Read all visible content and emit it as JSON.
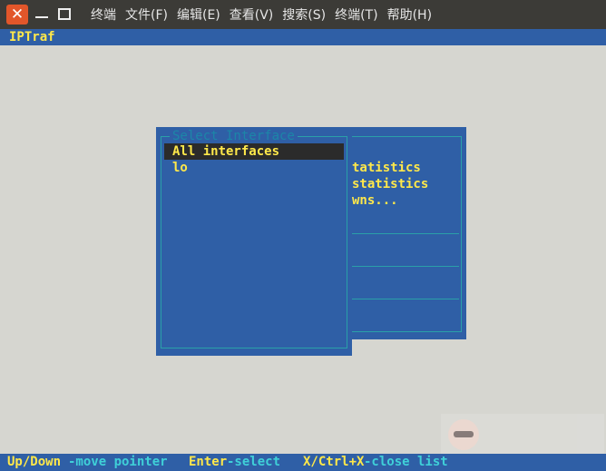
{
  "window": {
    "close_glyph": "✕",
    "menu": [
      "终端",
      "文件(F)",
      "编辑(E)",
      "查看(V)",
      "搜索(S)",
      "终端(T)",
      "帮助(H)"
    ]
  },
  "app": {
    "title": "IPTraf"
  },
  "main_menu": {
    "partial_lines": [
      "tatistics",
      "statistics",
      "wns..."
    ]
  },
  "interface_dialog": {
    "title": "Select Interface",
    "items": [
      "All interfaces",
      "lo"
    ],
    "selected_index": 0
  },
  "statusbar": {
    "hint1_key": "Up/Down",
    "hint1_desc": "-move pointer",
    "hint2_key": "Enter",
    "hint2_desc": "-select",
    "hint3_key": "X/Ctrl+X",
    "hint3_desc": "-close list"
  },
  "colors": {
    "terminal_bg": "#d6d6d0",
    "window_blue": "#2f5fa6",
    "highlight_yellow": "#ffe84a",
    "border_cyan": "#2aa0a8",
    "selection_bg": "#2b2b2b",
    "close_button": "#e2562a"
  }
}
